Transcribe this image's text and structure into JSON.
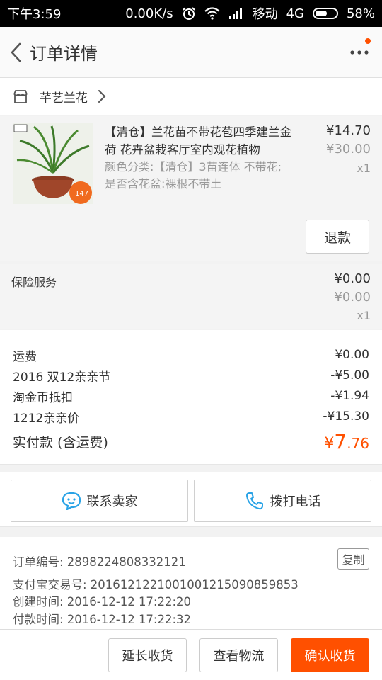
{
  "status_bar": {
    "time": "下午3:59",
    "speed": "0.00K/s",
    "carrier": "移动",
    "network": "4G",
    "battery": "58%"
  },
  "header": {
    "title": "订单详情"
  },
  "shop": {
    "name": "芊艺兰花"
  },
  "product": {
    "title": "【清仓】兰花苗不带花苞四季建兰金荷 花卉盆栽客厅室内观花植物",
    "spec": "颜色分类:【清仓】3苗连体 不带花;是否含花盆:裸根不带土",
    "price": "¥14.70",
    "original_price": "¥30.00",
    "quantity": "x1",
    "refund_label": "退款"
  },
  "insurance": {
    "label": "保险服务",
    "price": "¥0.00",
    "original_price": "¥0.00",
    "quantity": "x1"
  },
  "fees": {
    "rows": [
      {
        "label": "运费",
        "value": "¥0.00"
      },
      {
        "label": "2016 双12亲亲节",
        "value": "-¥5.00"
      },
      {
        "label": "淘金币抵扣",
        "value": "-¥1.94"
      },
      {
        "label": "1212亲亲价",
        "value": "-¥15.30"
      }
    ],
    "total_label": "实付款 (含运费)",
    "total_currency": "¥",
    "total_int": "7",
    "total_dec": ".76"
  },
  "contact": {
    "seller_label": "联系卖家",
    "phone_label": "拨打电话"
  },
  "order_info": {
    "order_no": "订单编号: 2898224808332121",
    "copy_label": "复制",
    "alipay_no": "支付宝交易号: 2016121221001001215090859853",
    "created": "创建时间: 2016-12-12 17:22:20",
    "paid": "付款时间: 2016-12-12 17:22:32"
  },
  "bottom_bar": {
    "extend_label": "延长收货",
    "logistics_label": "查看物流",
    "confirm_label": "确认收货"
  },
  "colors": {
    "accent": "#ff5000",
    "link_blue": "#2aa3e6"
  }
}
